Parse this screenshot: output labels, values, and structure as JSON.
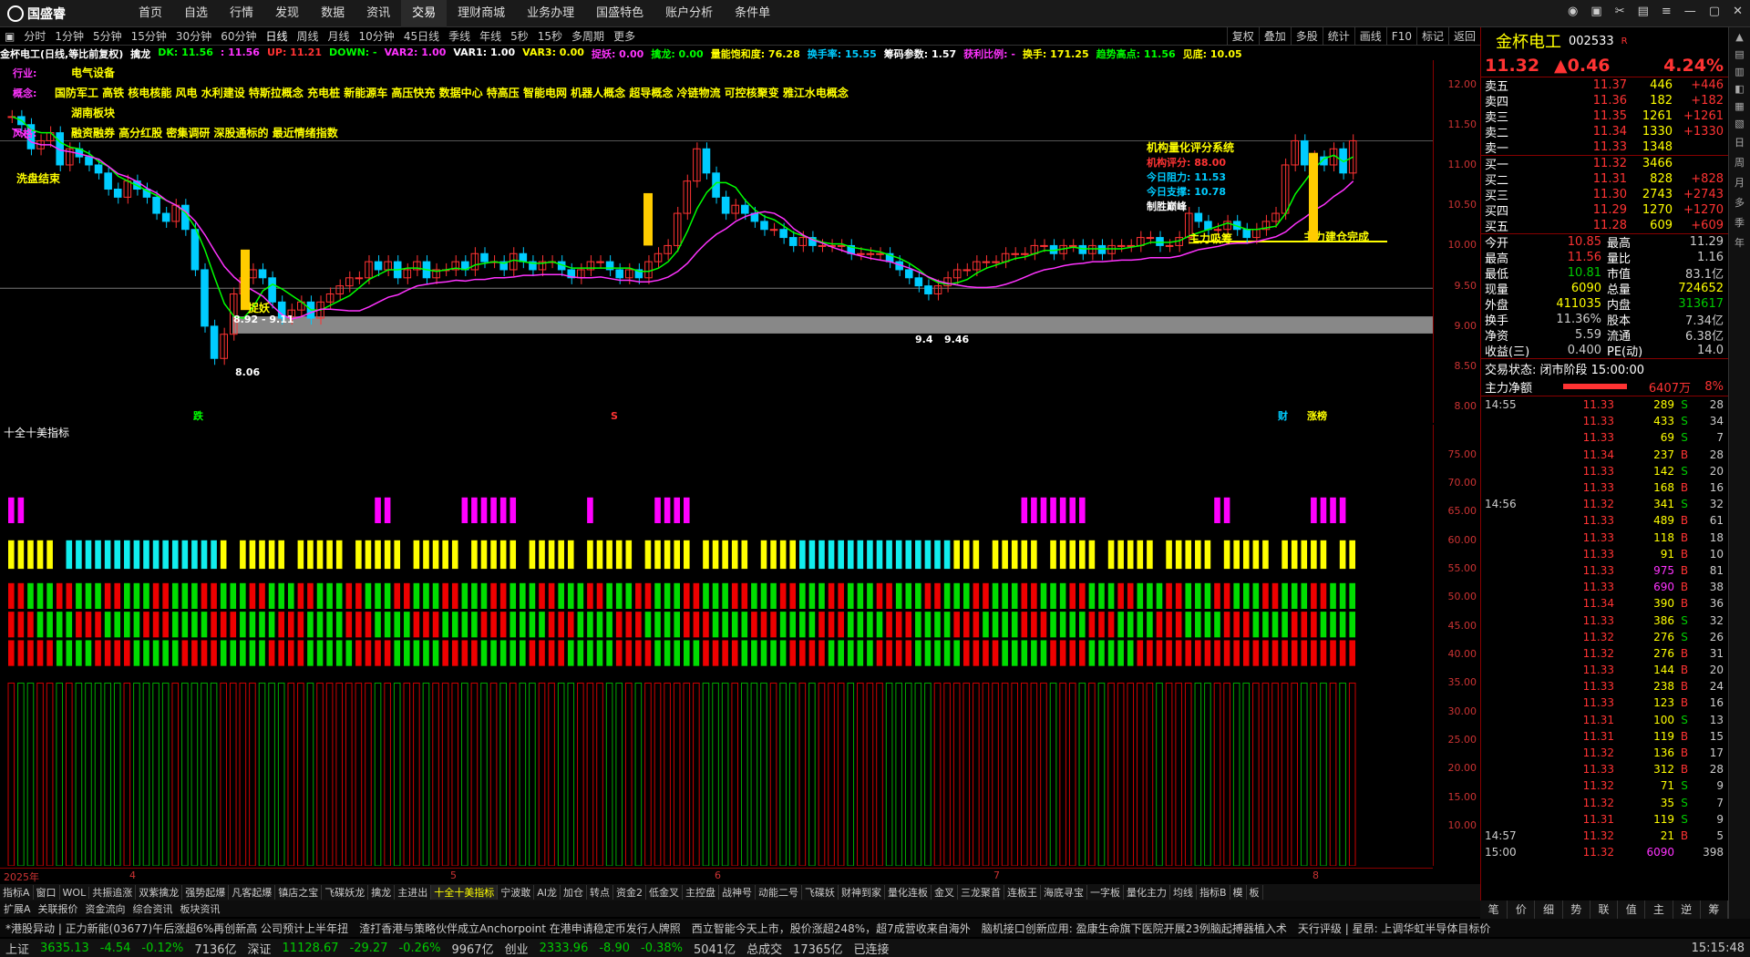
{
  "app": {
    "logo": "国盛睿"
  },
  "menu": [
    "首页",
    "自选",
    "行情",
    "发现",
    "数据",
    "资讯",
    "交易",
    "理财商城",
    "业务办理",
    "国盛特色",
    "账户分析",
    "条件单"
  ],
  "periods": [
    "分时",
    "1分钟",
    "5分钟",
    "15分钟",
    "30分钟",
    "60分钟",
    "日线",
    "周线",
    "月线",
    "10分钟",
    "45日线",
    "季线",
    "年线",
    "5秒",
    "15秒",
    "多周期",
    "更多"
  ],
  "tools": [
    "复权",
    "叠加",
    "多股",
    "统计",
    "画线",
    "F10",
    "标记",
    "返回"
  ],
  "indicator_line": [
    {
      "t": "金杯电工(日线,等比前复权)",
      "c": "#fff"
    },
    {
      "t": "擒龙",
      "c": "#fff"
    },
    {
      "t": "DK: 11.56",
      "c": "#0f0"
    },
    {
      "t": ": 11.56",
      "c": "#f3f"
    },
    {
      "t": "UP: 11.21",
      "c": "#f33"
    },
    {
      "t": "DOWN: -",
      "c": "#0f0"
    },
    {
      "t": "VAR2: 1.00",
      "c": "#f3f"
    },
    {
      "t": "VAR1: 1.00",
      "c": "#fff"
    },
    {
      "t": "VAR3: 0.00",
      "c": "#ff0"
    },
    {
      "t": "捉妖: 0.00",
      "c": "#f3f"
    },
    {
      "t": "擒龙: 0.00",
      "c": "#0f0"
    },
    {
      "t": "量能饱和度: 76.28",
      "c": "#ff0"
    },
    {
      "t": "换手率: 15.55",
      "c": "#0cf"
    },
    {
      "t": "筹码参数: 1.57",
      "c": "#fff"
    },
    {
      "t": "获利比例: -",
      "c": "#f3f"
    },
    {
      "t": "换手: 171.25",
      "c": "#ff0"
    },
    {
      "t": "趋势高点: 11.56",
      "c": "#0f0"
    },
    {
      "t": "见底: 10.05",
      "c": "#ff0"
    }
  ],
  "overlay": {
    "industry_label": "行业:",
    "industry": "电气设备",
    "concept_label": "概念:",
    "concepts": "国防军工 高铁 核电核能 风电 水利建设 特斯拉概念 充电桩 新能源车 高压快充 数据中心 特高压 智能电网 机器人概念 超导概念 冷链物流 可控核聚变 雅江水电概念",
    "region": "湖南板块",
    "style_label": "风格:",
    "styles": "融资融券 高分红股 密集调研 深股通标的 最近情绪指数",
    "wash": "洗盘结束",
    "zhuoyao": "捉妖",
    "lo_range": "8.92 - 9.11",
    "low": "8.06",
    "level946a": "9.4",
    "level946b": "9.46",
    "zhulixichou": "主力吸筹",
    "zhuli_wancheng": "主力建仓完成",
    "sys_title": "机构量化评分系统",
    "score": "机构评分: 88.00",
    "resist": "今日阻力: 11.53",
    "support": "今日支撑: 10.78",
    "fear": "制胜巅峰",
    "mark_die": "跌",
    "mark_s": "S",
    "mark_cai": "财",
    "mark_zhangbang": "涨榜"
  },
  "axis_main": [
    "12.00",
    "11.50",
    "11.00",
    "10.50",
    "10.00",
    "9.50",
    "9.00",
    "8.50",
    "8.00"
  ],
  "axis_sub": [
    "75.00",
    "70.00",
    "65.00",
    "60.00",
    "55.00",
    "50.00",
    "45.00",
    "40.00",
    "35.00",
    "30.00",
    "25.00",
    "20.00",
    "15.00",
    "10.00"
  ],
  "sub_title": "十全十美指标",
  "dates": [
    {
      "t": "2025年",
      "x": 4
    },
    {
      "t": "4",
      "x": 142
    },
    {
      "t": "5",
      "x": 494
    },
    {
      "t": "6",
      "x": 784
    },
    {
      "t": "7",
      "x": 1090
    },
    {
      "t": "8",
      "x": 1440
    }
  ],
  "tabs1": [
    "指标A",
    "窗口",
    "WOL",
    "共振追涨",
    "双紫擒龙",
    "强势起爆",
    "凡客起爆",
    "镇店之宝",
    "飞碟妖龙",
    "擒龙",
    "主进出",
    "十全十美指标",
    "宁波敢",
    "AI龙",
    "加仓",
    "转点",
    "资金2",
    "低金叉",
    "主控盘",
    "战神号",
    "动能二号",
    "飞碟妖",
    "财神到家",
    "量化连板",
    "金叉",
    "三龙聚首",
    "连板王",
    "海底寻宝",
    "一字板",
    "量化主力",
    "均线",
    "指标B",
    "模",
    "板"
  ],
  "tabs1_active": "十全十美指标",
  "tabs2": [
    "扩展A",
    "关联报价",
    "资金流向",
    "综合资讯",
    "板块资讯"
  ],
  "news_ticker": [
    "*港股异动 | 正力新能(03677)午后涨超6%再创新高 公司预计上半年扭",
    "渣打香港与策略伙伴成立Anchorpoint 在港申请稳定币发行人牌照",
    "西立智能今天上市，股价涨超248%，超7成营收来自海外",
    "脑机接口创新应用: 盈康生命旗下医院开展23例脑起搏器植入术",
    "天行评级 | 星昂: 上调华虹半导体目标价"
  ],
  "status": [
    {
      "t": "上证",
      "c": "#ccc"
    },
    {
      "t": "3635.13",
      "c": "#0c0"
    },
    {
      "t": "-4.54",
      "c": "#0c0"
    },
    {
      "t": "-0.12%",
      "c": "#0c0"
    },
    {
      "t": "7136亿",
      "c": "#ccc"
    },
    {
      "t": "深证",
      "c": "#ccc"
    },
    {
      "t": "11128.67",
      "c": "#0c0"
    },
    {
      "t": "-29.27",
      "c": "#0c0"
    },
    {
      "t": "-0.26%",
      "c": "#0c0"
    },
    {
      "t": "9967亿",
      "c": "#ccc"
    },
    {
      "t": "创业",
      "c": "#ccc"
    },
    {
      "t": "2333.96",
      "c": "#0c0"
    },
    {
      "t": "-8.90",
      "c": "#0c0"
    },
    {
      "t": "-0.38%",
      "c": "#0c0"
    },
    {
      "t": "5041亿",
      "c": "#ccc"
    },
    {
      "t": "总成交",
      "c": "#ccc"
    },
    {
      "t": "17365亿",
      "c": "#ccc"
    },
    {
      "t": "已连接",
      "c": "#ccc"
    }
  ],
  "clock": "15:15:48",
  "quote": {
    "name": "金杯电工",
    "code": "002533",
    "flag": "R",
    "price": "11.32",
    "change": "0.46",
    "pct": "4.24%",
    "asks": [
      [
        "卖五",
        "11.37",
        "446",
        "+446"
      ],
      [
        "卖四",
        "11.36",
        "182",
        "+182"
      ],
      [
        "卖三",
        "11.35",
        "1261",
        "+1261"
      ],
      [
        "卖二",
        "11.34",
        "1330",
        "+1330"
      ],
      [
        "卖一",
        "11.33",
        "1348",
        ""
      ]
    ],
    "bids": [
      [
        "买一",
        "11.32",
        "3466",
        ""
      ],
      [
        "买二",
        "11.31",
        "828",
        "+828"
      ],
      [
        "买三",
        "11.30",
        "2743",
        "+2743"
      ],
      [
        "买四",
        "11.29",
        "1270",
        "+1270"
      ],
      [
        "买五",
        "11.28",
        "609",
        "+609"
      ]
    ],
    "stats": [
      [
        "今开",
        "10.85",
        "最高",
        "11.29"
      ],
      [
        "最高",
        "11.56",
        "量比",
        "1.16"
      ],
      [
        "最低",
        "10.81",
        "市值",
        "83.1亿"
      ],
      [
        "现量",
        "6090",
        "总量",
        "724652"
      ],
      [
        "外盘",
        "411035",
        "内盘",
        "313617"
      ],
      [
        "换手",
        "11.36%",
        "股本",
        "7.34亿"
      ],
      [
        "净资",
        "5.59",
        "流通",
        "6.38亿"
      ],
      [
        "收益(三)",
        "0.400",
        "PE(动)",
        "14.0"
      ]
    ],
    "trade_state": "交易状态: 闭市阶段 15:00:00",
    "net_label": "主力净额",
    "net_val": "6407万",
    "net_pct": "8%"
  },
  "ticks": [
    [
      "14:55",
      "11.33",
      "289",
      "S",
      "28"
    ],
    [
      "",
      "11.33",
      "433",
      "S",
      "34"
    ],
    [
      "",
      "11.33",
      "69",
      "S",
      "7"
    ],
    [
      "",
      "11.34",
      "237",
      "B",
      "28"
    ],
    [
      "",
      "11.33",
      "142",
      "S",
      "20"
    ],
    [
      "",
      "11.33",
      "168",
      "B",
      "16"
    ],
    [
      "14:56",
      "11.32",
      "341",
      "S",
      "32"
    ],
    [
      "",
      "11.33",
      "489",
      "B",
      "61"
    ],
    [
      "",
      "11.33",
      "118",
      "B",
      "18"
    ],
    [
      "",
      "11.33",
      "91",
      "B",
      "10"
    ],
    [
      "",
      "11.33",
      "975",
      "B",
      "81"
    ],
    [
      "",
      "11.33",
      "690",
      "B",
      "38"
    ],
    [
      "",
      "11.34",
      "390",
      "B",
      "36"
    ],
    [
      "",
      "11.33",
      "386",
      "S",
      "32"
    ],
    [
      "",
      "11.32",
      "276",
      "S",
      "26"
    ],
    [
      "",
      "11.32",
      "276",
      "B",
      "31"
    ],
    [
      "",
      "11.33",
      "144",
      "B",
      "20"
    ],
    [
      "",
      "11.33",
      "238",
      "B",
      "24"
    ],
    [
      "",
      "11.33",
      "123",
      "B",
      "16"
    ],
    [
      "",
      "11.31",
      "100",
      "S",
      "13"
    ],
    [
      "",
      "11.31",
      "119",
      "B",
      "15"
    ],
    [
      "",
      "11.32",
      "136",
      "B",
      "17"
    ],
    [
      "",
      "11.33",
      "312",
      "B",
      "28"
    ],
    [
      "",
      "11.32",
      "71",
      "S",
      "9"
    ],
    [
      "",
      "11.32",
      "35",
      "S",
      "7"
    ],
    [
      "",
      "11.31",
      "119",
      "S",
      "9"
    ],
    [
      "14:57",
      "11.32",
      "21",
      "B",
      "5"
    ],
    [
      "15:00",
      "11.32",
      "6090",
      "",
      "398"
    ]
  ],
  "rtabs": [
    "笔",
    "价",
    "细",
    "势",
    "联",
    "值",
    "主",
    "逆",
    "筹"
  ],
  "rside": [
    "日",
    "周",
    "月",
    "多",
    "季",
    "年"
  ],
  "chart_data": {
    "type": "candlestick",
    "title": "金杯电工(日线,等比前复权)",
    "ylim": [
      7.8,
      12.3
    ],
    "closes": [
      11.6,
      11.5,
      11.2,
      11.3,
      11.4,
      11.0,
      11.2,
      11.1,
      11.0,
      10.9,
      10.7,
      10.6,
      10.8,
      10.7,
      10.6,
      10.4,
      10.3,
      10.5,
      10.2,
      9.7,
      9.0,
      8.6,
      8.9,
      9.4,
      9.6,
      9.7,
      9.6,
      9.3,
      9.1,
      9.2,
      9.3,
      9.1,
      9.3,
      9.4,
      9.5,
      9.6,
      9.6,
      9.8,
      9.7,
      9.8,
      9.6,
      9.7,
      9.8,
      9.6,
      9.7,
      9.7,
      9.8,
      9.7,
      9.9,
      9.8,
      9.8,
      9.7,
      9.9,
      9.8,
      9.7,
      9.8,
      9.8,
      9.7,
      9.6,
      9.7,
      9.8,
      9.8,
      9.7,
      9.6,
      9.7,
      9.6,
      9.8,
      9.9,
      10.0,
      10.4,
      10.8,
      11.2,
      10.9,
      10.6,
      10.4,
      10.5,
      10.4,
      10.3,
      10.2,
      10.2,
      10.1,
      10.0,
      10.1,
      10.0,
      10.0,
      10.0,
      10.0,
      9.9,
      9.9,
      9.9,
      9.9,
      9.8,
      9.7,
      9.6,
      9.5,
      9.4,
      9.5,
      9.6,
      9.7,
      9.7,
      9.8,
      9.8,
      9.8,
      9.9,
      9.9,
      9.9,
      10.0,
      10.0,
      9.9,
      10.0,
      10.0,
      9.9,
      10.0,
      9.9,
      10.0,
      10.0,
      10.0,
      10.1,
      10.1,
      10.0,
      10.0,
      10.1,
      10.4,
      10.3,
      10.2,
      10.2,
      10.3,
      10.2,
      10.1,
      10.2,
      10.3,
      10.4,
      11.0,
      11.3,
      11.0,
      11.1,
      11.0,
      11.2,
      10.9,
      11.3
    ]
  }
}
